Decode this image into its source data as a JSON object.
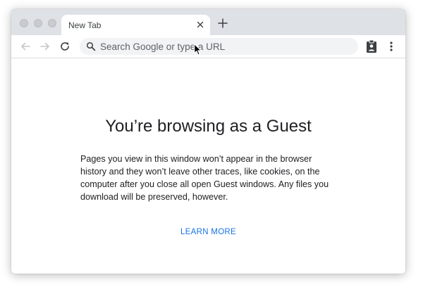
{
  "tabs": [
    {
      "title": "New Tab",
      "active": true
    }
  ],
  "toolbar": {
    "omnibox_placeholder": "Search Google or type a URL"
  },
  "page": {
    "headline": "You’re browsing as a Guest",
    "body": "Pages you view in this window won’t appear in the browser history and they won’t leave other traces, like cookies, on the computer after you close all open Guest windows. Any files you download will be preserved, however.",
    "learn_more": "LEARN MORE"
  },
  "icons": {
    "window_close": "traffic-light-close",
    "window_minimize": "traffic-light-minimize",
    "window_maximize": "traffic-light-maximize",
    "tab_close": "close-icon",
    "new_tab": "plus-icon",
    "back": "arrow-left-icon",
    "forward": "arrow-right-icon",
    "reload": "reload-icon",
    "search": "search-icon",
    "extension": "clipboard-person-icon",
    "menu": "kebab-menu-icon",
    "cursor": "mouse-pointer-icon"
  },
  "colors": {
    "tabstrip_bg": "#dee1e6",
    "omnibox_bg": "#f1f3f4",
    "link": "#1a73e8",
    "text": "#202124",
    "icon_gray": "#5f6368",
    "icon_disabled": "#c4c7c9"
  }
}
